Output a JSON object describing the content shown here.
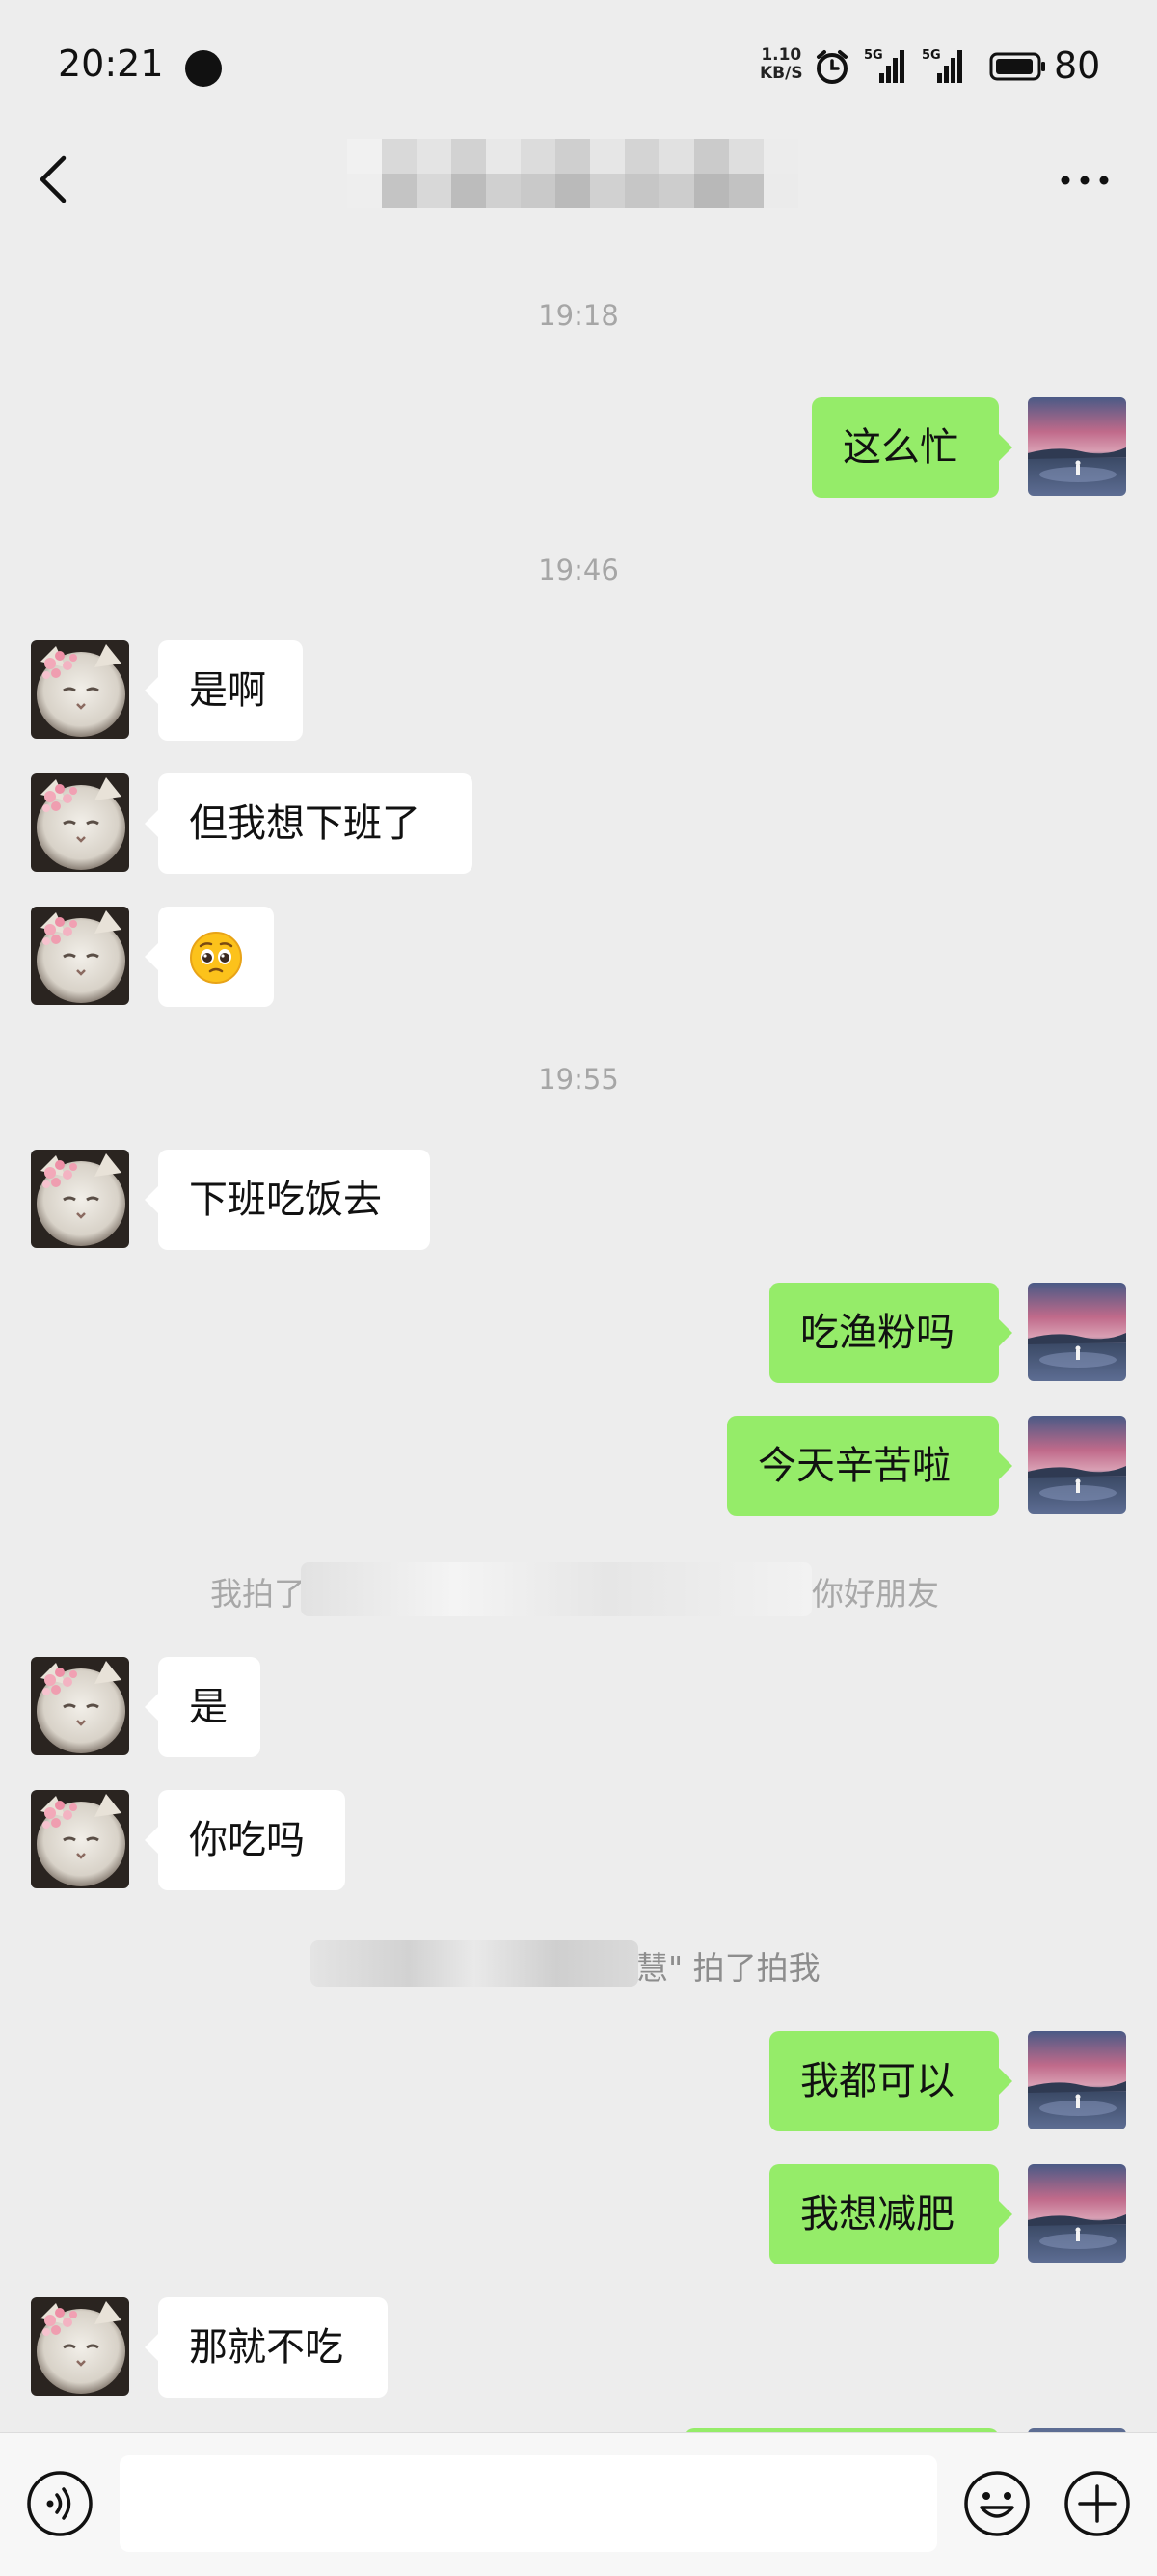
{
  "status_bar": {
    "time": "20:21",
    "net_speed_value": "1.10",
    "net_speed_unit": "KB/S",
    "signal1_label": "5G",
    "signal2_label": "5G",
    "battery": "80"
  },
  "nav": {
    "back_icon": "chevron-left-icon",
    "more_icon": "more-dots-icon"
  },
  "messages": {
    "t1": "19:18",
    "m1": "这么忙",
    "t2": "19:46",
    "m2": "是啊",
    "m3": "但我想下班了",
    "m4": "🥺",
    "t3": "19:55",
    "m5": "下班吃饭去",
    "m6": "吃渔粉吗",
    "m7": "今天辛苦啦",
    "sys1_left": "我拍了",
    "sys1_right": "你好朋友",
    "m8": "是",
    "m9": "你吃吗",
    "sys2_right": "慧\" 拍了拍我",
    "m10": "我都可以",
    "m11": "我想减肥",
    "m12": "那就不吃"
  },
  "input_bar": {
    "voice_icon": "voice-icon",
    "text_value": "",
    "emoji_icon": "emoji-icon",
    "plus_icon": "plus-icon"
  },
  "colors": {
    "background": "#ededed",
    "outgoing_bubble": "#95ec69",
    "incoming_bubble": "#ffffff"
  }
}
